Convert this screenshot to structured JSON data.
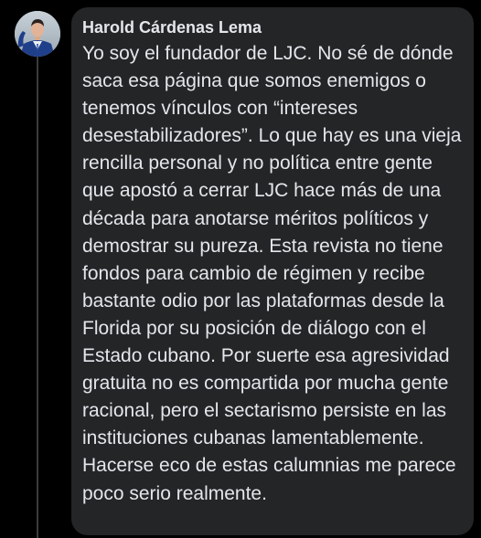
{
  "comment": {
    "author": "Harold Cárdenas Lema",
    "text": "Yo soy el fundador de LJC. No sé de dónde saca esa página que somos enemigos o tenemos vínculos con “intereses desestabilizadores”. Lo que hay es una vieja rencilla personal y no política entre gente que apostó a cerrar LJC hace más de una década para anotarse méritos políticos y demostrar su pureza. Esta revista no tiene fondos para cambio de régimen y recibe bastante odio por las plataformas desde la Florida por su posición de diálogo con el Estado cubano. Por suerte esa agresividad gratuita no es compartida por mucha gente racional, pero el sectarismo persiste en las instituciones cubanas lamentablemente. Hacerse eco de estas calumnias me parece poco serio realmente."
  },
  "colors": {
    "background": "#000000",
    "bubble": "#242526",
    "text": "#e4e6eb",
    "thread_line": "#3a3b3c"
  },
  "icons": {
    "avatar": "profile-photo"
  }
}
